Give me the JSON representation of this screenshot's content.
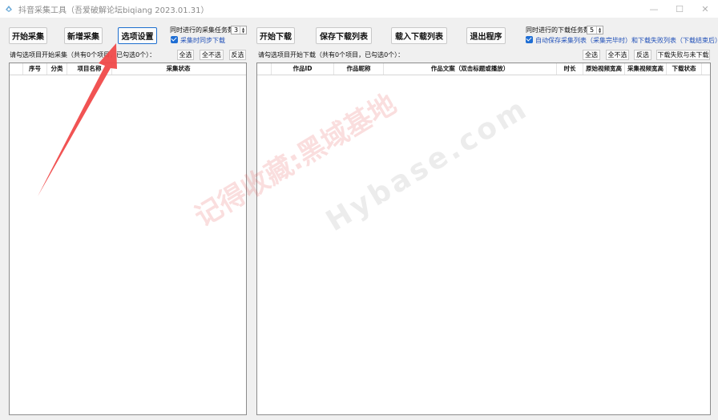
{
  "window": {
    "title": "抖音采集工具（吾爱破解论坛biqiang 2023.01.31）",
    "controls": [
      "—",
      "☐",
      "✕"
    ]
  },
  "toolbar_left": {
    "start_collect": "开始采集",
    "add_collect": "新增采集",
    "options": "选项设置",
    "concurrent_label": "同时进行的采集任务数",
    "concurrent_value": "3",
    "sync_download_label": "采集时同步下载"
  },
  "toolbar_right": {
    "start_download": "开始下载",
    "save_list": "保存下载列表",
    "load_list": "载入下载列表",
    "exit": "退出程序",
    "concurrent_label": "同时进行的下载任务数",
    "concurrent_value": "5",
    "autosave_label": "自动保存采集列表（采集完毕时）和下载失败列表（下载结束后）"
  },
  "left_panel": {
    "hint": "请勾选项目开始采集（共有0个项目，已勾选0个）：",
    "select_all": "全选",
    "select_none": "全不选",
    "invert": "反选",
    "columns": [
      "序号",
      "分类",
      "项目名称",
      "采集状态"
    ]
  },
  "right_panel": {
    "hint": "请勾选项目开始下载（共有0个项目，已勾选0个）：",
    "select_all": "全选",
    "select_none": "全不选",
    "invert": "反选",
    "download_fail_button": "下载失败与未下载",
    "columns": [
      "作品ID",
      "作品昵称",
      "作品文案（双击标题或播放）",
      "时长",
      "原始视频宽高",
      "采集视频宽高",
      "下载状态"
    ]
  },
  "watermark": {
    "text1": "记得收藏:黑域基地",
    "text2": "Hybase.com"
  },
  "colors": {
    "accent": "#1f6ed4",
    "arrow": "#f04a4a",
    "window_bg": "#f0f0f0"
  }
}
